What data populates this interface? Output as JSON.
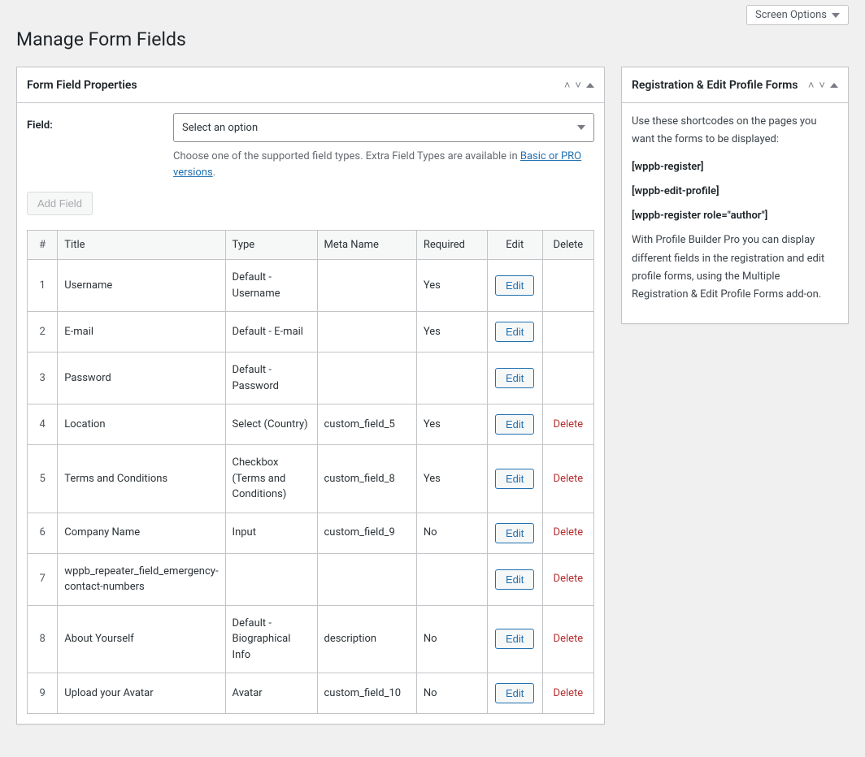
{
  "topbar": {
    "screen_options": "Screen Options"
  },
  "page_title": "Manage Form Fields",
  "main_box": {
    "title": "Form Field Properties",
    "field_label": "Field:",
    "select_placeholder": "Select an option",
    "helptext_prefix": "Choose one of the supported field types. Extra Field Types are available in ",
    "helptext_link": "Basic or PRO versions",
    "helptext_suffix": ".",
    "add_field": "Add Field"
  },
  "table": {
    "headers": {
      "num": "#",
      "title": "Title",
      "type": "Type",
      "meta": "Meta Name",
      "required": "Required",
      "edit": "Edit",
      "delete": "Delete"
    },
    "edit_label": "Edit",
    "delete_label": "Delete",
    "rows": [
      {
        "num": "1",
        "title": "Username",
        "type": "Default - Username",
        "meta": "",
        "required": "Yes",
        "deletable": false
      },
      {
        "num": "2",
        "title": "E-mail",
        "type": "Default - E-mail",
        "meta": "",
        "required": "Yes",
        "deletable": false
      },
      {
        "num": "3",
        "title": "Password",
        "type": "Default - Password",
        "meta": "",
        "required": "",
        "deletable": false
      },
      {
        "num": "4",
        "title": "Location",
        "type": "Select (Country)",
        "meta": "custom_field_5",
        "required": "Yes",
        "deletable": true
      },
      {
        "num": "5",
        "title": "Terms and Conditions",
        "type": "Checkbox (Terms and Conditions)",
        "meta": "custom_field_8",
        "required": "Yes",
        "deletable": true
      },
      {
        "num": "6",
        "title": "Company Name",
        "type": "Input",
        "meta": "custom_field_9",
        "required": "No",
        "deletable": true
      },
      {
        "num": "7",
        "title": "wppb_repeater_field_emergency-contact-numbers",
        "type": "",
        "meta": "",
        "required": "",
        "deletable": true
      },
      {
        "num": "8",
        "title": "About Yourself",
        "type": "Default - Biographical Info",
        "meta": "description",
        "required": "No",
        "deletable": true
      },
      {
        "num": "9",
        "title": "Upload your Avatar",
        "type": "Avatar",
        "meta": "custom_field_10",
        "required": "No",
        "deletable": true
      }
    ]
  },
  "side_box": {
    "title": "Registration & Edit Profile Forms",
    "intro": "Use these shortcodes on the pages you want the forms to be displayed:",
    "shortcodes": [
      "[wppb-register]",
      "[wppb-edit-profile]",
      "[wppb-register role=\"author\"]"
    ],
    "outro": "With Profile Builder Pro you can display different fields in the registration and edit profile forms, using the Multiple Registration & Edit Profile Forms add-on."
  }
}
